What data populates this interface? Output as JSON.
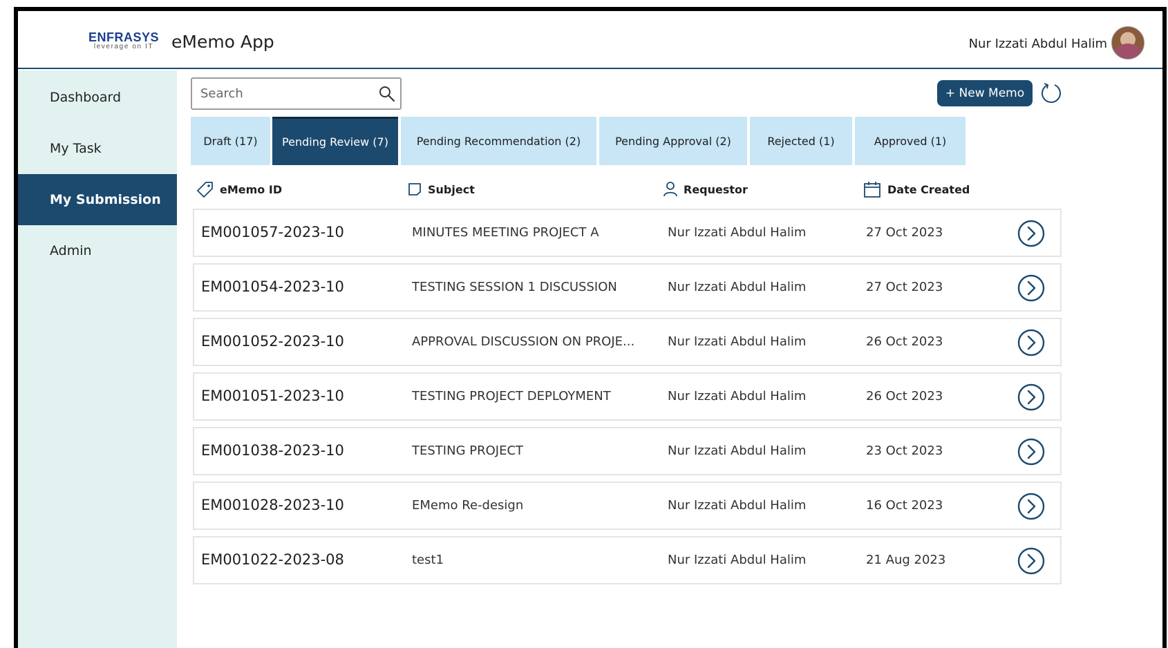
{
  "header": {
    "logo_main": "ENFRASYS",
    "logo_tagline": "leverage on IT",
    "app_title": "eMemo App",
    "user_name": "Nur Izzati Abdul Halim"
  },
  "sidebar": {
    "items": [
      {
        "label": "Dashboard",
        "active": false
      },
      {
        "label": "My Task",
        "active": false
      },
      {
        "label": "My Submission",
        "active": true
      },
      {
        "label": "Admin",
        "active": false
      }
    ]
  },
  "toolbar": {
    "search_placeholder": "Search",
    "new_memo_label": "+ New Memo"
  },
  "tabs": [
    {
      "label": "Draft (17)",
      "active": false
    },
    {
      "label": "Pending Review (7)",
      "active": true
    },
    {
      "label": "Pending Recommendation (2)",
      "active": false
    },
    {
      "label": "Pending Approval (2)",
      "active": false
    },
    {
      "label": "Rejected (1)",
      "active": false
    },
    {
      "label": "Approved (1)",
      "active": false
    }
  ],
  "table": {
    "columns": [
      "eMemo ID",
      "Subject",
      "Requestor",
      "Date Created"
    ],
    "rows": [
      {
        "id": "EM001057-2023-10",
        "subject": "MINUTES MEETING PROJECT A",
        "requestor": "Nur Izzati Abdul Halim",
        "date": "27 Oct 2023"
      },
      {
        "id": "EM001054-2023-10",
        "subject": "TESTING SESSION 1 DISCUSSION",
        "requestor": "Nur Izzati Abdul Halim",
        "date": "27 Oct 2023"
      },
      {
        "id": "EM001052-2023-10",
        "subject": "APPROVAL DISCUSSION ON PROJE...",
        "requestor": "Nur Izzati Abdul Halim",
        "date": "26 Oct 2023"
      },
      {
        "id": "EM001051-2023-10",
        "subject": "TESTING PROJECT DEPLOYMENT",
        "requestor": "Nur Izzati Abdul Halim",
        "date": "26 Oct 2023"
      },
      {
        "id": "EM001038-2023-10",
        "subject": "TESTING PROJECT",
        "requestor": "Nur Izzati Abdul Halim",
        "date": "23 Oct 2023"
      },
      {
        "id": "EM001028-2023-10",
        "subject": "EMemo Re-design",
        "requestor": "Nur Izzati Abdul Halim",
        "date": "16 Oct 2023"
      },
      {
        "id": "EM001022-2023-08",
        "subject": "test1",
        "requestor": "Nur Izzati Abdul Halim",
        "date": "21 Aug 2023"
      }
    ]
  },
  "colors": {
    "primary": "#1c4a6e",
    "tab_bg": "#c8e6f5",
    "sidebar_bg": "#e1f2f0"
  }
}
